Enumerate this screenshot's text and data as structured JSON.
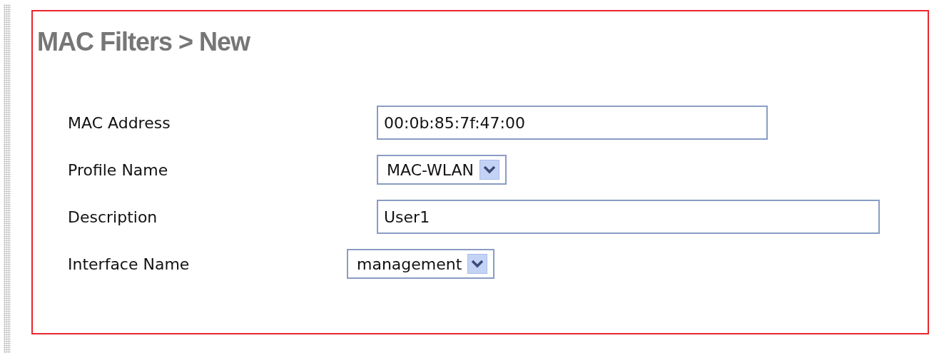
{
  "title": "MAC Filters > New",
  "fields": [
    {
      "kind": "text",
      "label": "MAC Address",
      "value": "00:0b:85:7f:47:00"
    },
    {
      "kind": "select",
      "label": "Profile Name",
      "value": "MAC-WLAN"
    },
    {
      "kind": "text",
      "label": "Description",
      "value": "User1"
    },
    {
      "kind": "select",
      "label": "Interface Name",
      "value": "management"
    }
  ]
}
